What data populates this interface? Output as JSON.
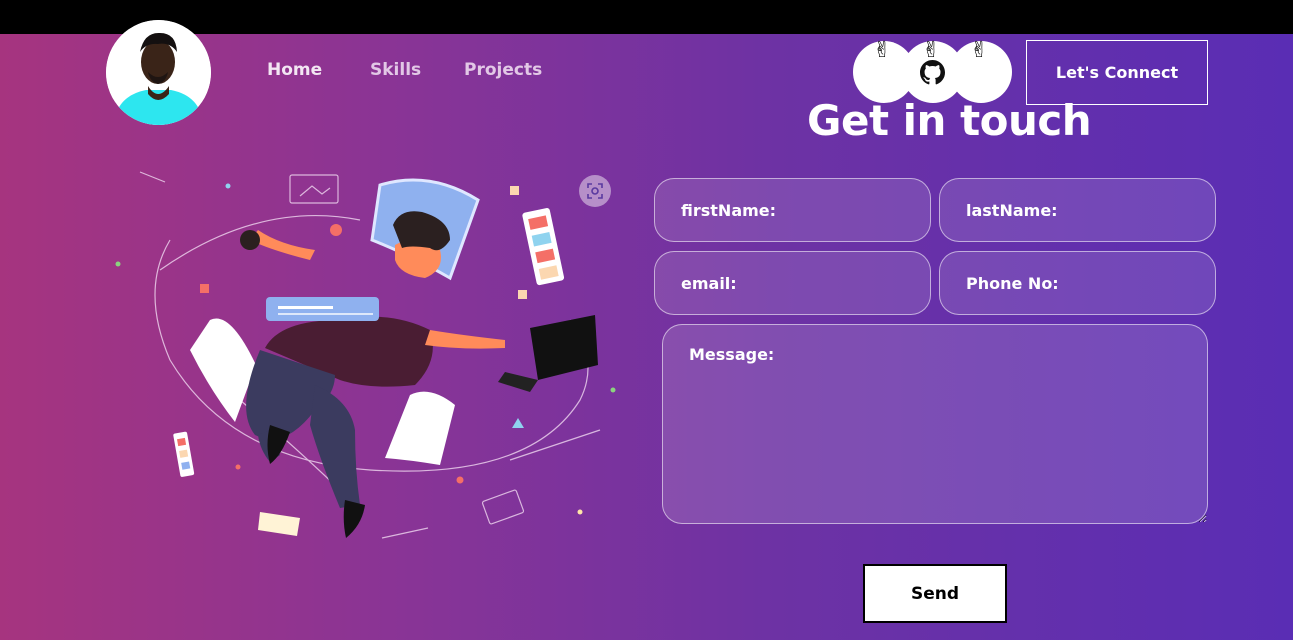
{
  "nav": {
    "home": "Home",
    "skills": "Skills",
    "projects": "Projects"
  },
  "social": {
    "icons": [
      "victory-hand-icon",
      "github-icon",
      "victory-hand-icon"
    ],
    "emoji": "✌"
  },
  "header": {
    "connect_label": "Let's Connect"
  },
  "contact": {
    "title": "Get in touch",
    "first_name_placeholder": "firstName:",
    "last_name_placeholder": "lastName:",
    "email_placeholder": "email:",
    "phone_placeholder": "Phone No:",
    "message_placeholder": "Message:",
    "send_label": "Send"
  },
  "colors": {
    "gradient_start": "#a6347f",
    "gradient_end": "#5a2db4",
    "avatar_accent": "#2de6ef",
    "topbar": "#000000"
  }
}
